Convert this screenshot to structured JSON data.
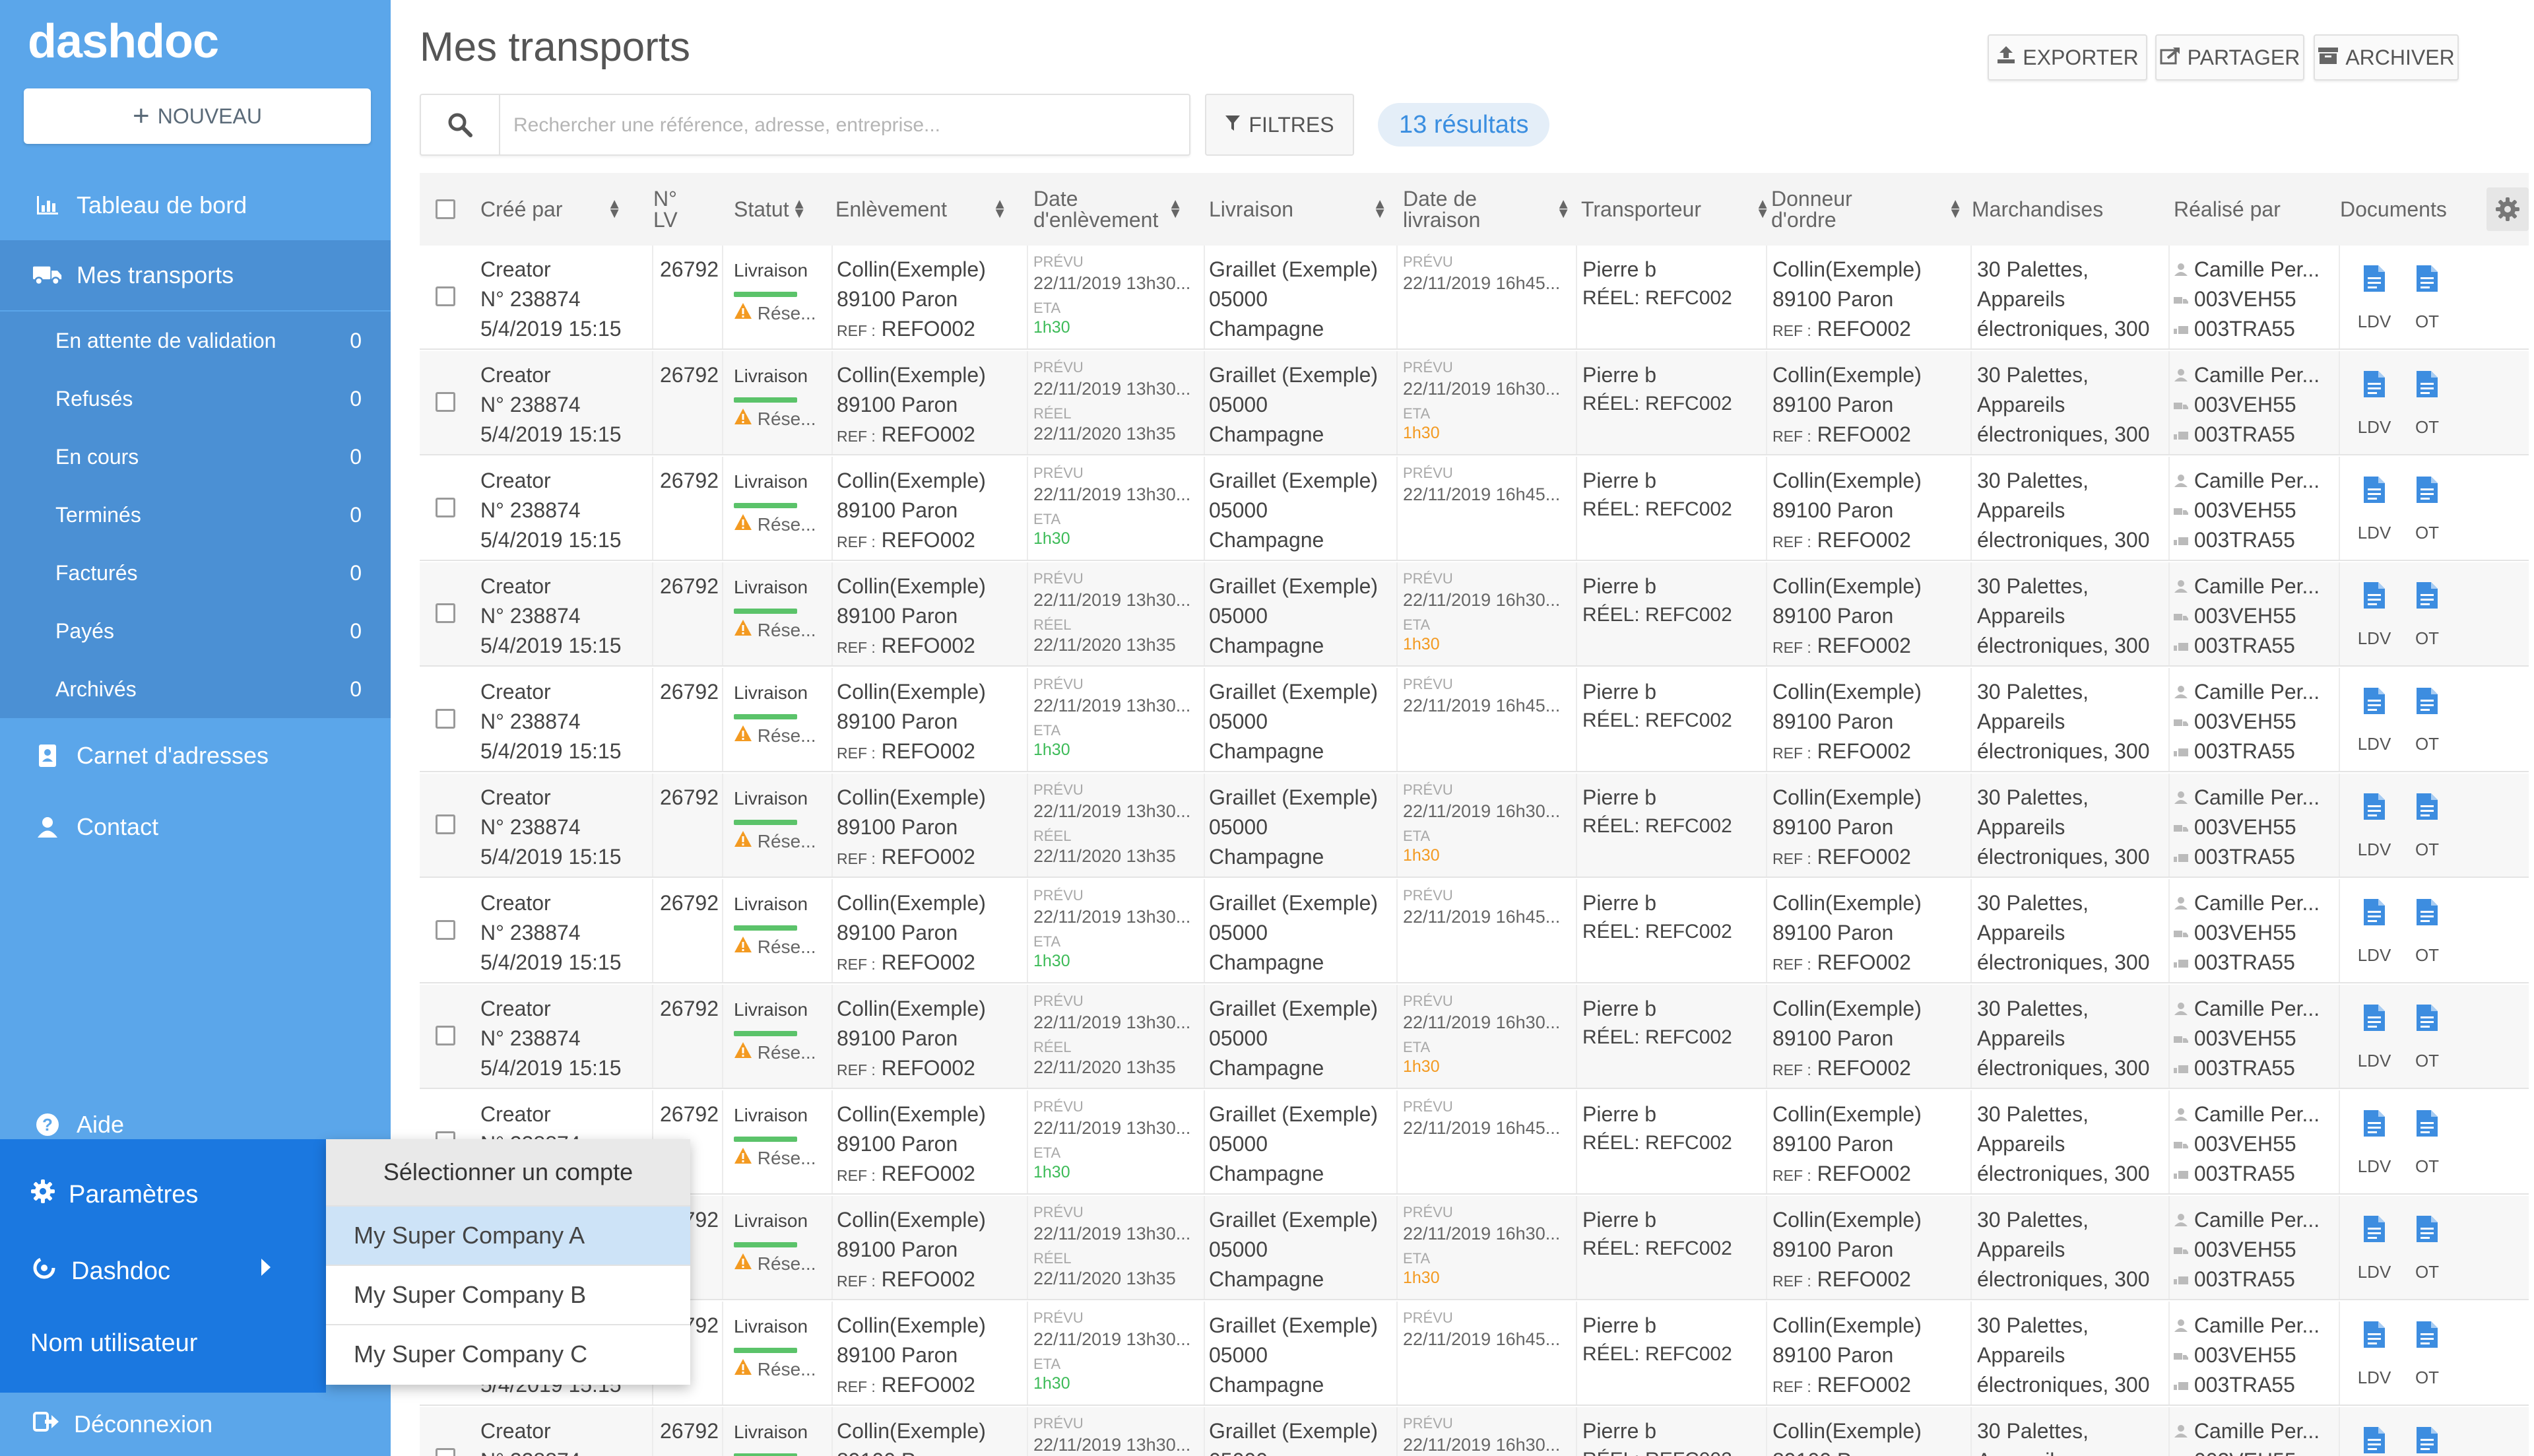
{
  "app": {
    "logo": "dashdoc"
  },
  "sidebar": {
    "new_button": "NOUVEAU",
    "nav": {
      "dashboard": "Tableau de bord",
      "transports": "Mes transports",
      "addresses": "Carnet d'adresses",
      "contact": "Contact",
      "help": "Aide"
    },
    "sub_items": [
      {
        "label": "En attente de validation",
        "count": "0"
      },
      {
        "label": "Refusés",
        "count": "0"
      },
      {
        "label": "En cours",
        "count": "0"
      },
      {
        "label": "Terminés",
        "count": "0"
      },
      {
        "label": "Facturés",
        "count": "0"
      },
      {
        "label": "Payés",
        "count": "0"
      },
      {
        "label": "Archivés",
        "count": "0"
      }
    ],
    "bottom": {
      "settings": "Paramètres",
      "company": "Dashdoc",
      "username": "Nom utilisateur",
      "logout": "Déconnexion"
    }
  },
  "account_menu": {
    "title": "Sélectionner un compte",
    "items": [
      "My Super Company A",
      "My Super Company B",
      "My Super Company C"
    ],
    "selected": "My Super Company A"
  },
  "header": {
    "title": "Mes transports",
    "actions": {
      "export": "EXPORTER",
      "share": "PARTAGER",
      "archive": "ARCHIVER"
    }
  },
  "search": {
    "placeholder": "Rechercher une référence, adresse, entreprise..."
  },
  "filters": {
    "label": "FILTRES"
  },
  "results": {
    "label": "13 résultats"
  },
  "table": {
    "columns": {
      "created_by": "Créé par",
      "lv_line1": "N°",
      "lv_line2": "LV",
      "status": "Statut",
      "pickup": "Enlèvement",
      "pickup_date_line1": "Date",
      "pickup_date_line2": "d'enlèvement",
      "delivery": "Livraison",
      "delivery_date_line1": "Date de",
      "delivery_date_line2": "livraison",
      "carrier": "Transporteur",
      "shipper_line1": "Donneur",
      "shipper_line2": "d'ordre",
      "goods": "Marchandises",
      "done_by": "Réalisé par",
      "documents": "Documents"
    },
    "row_common": {
      "creator": "Creator",
      "number": "N° 238874",
      "created_at": "5/4/2019 15:15",
      "lv": "26792",
      "status": "Livraison",
      "status_sub": "Rése...",
      "pickup_company": "Collin(Exemple)",
      "pickup_city": "89100 Paron",
      "ref_label": "REF :",
      "ref": "REFO002",
      "planned_label": "PRÉVU",
      "planned_pickup": "22/11/2019 13h30...",
      "eta_label": "ETA",
      "real_label": "RÉEL",
      "real_date": "22/11/2020 13h35",
      "eta_value": "1h30",
      "delivery_company": "Graillet (Exemple)",
      "delivery_zip": "05000",
      "delivery_city": "Champagne",
      "delivery_planned_a": "22/11/2019 16h45...",
      "delivery_planned_b": "22/11/2019 16h30...",
      "carrier_name": "Pierre b",
      "carrier_ref": "RÉEL: REFC002",
      "shipper_company": "Collin(Exemple)",
      "shipper_city": "89100 Paron",
      "goods_l1": "30 Palettes,",
      "goods_l2": "Appareils",
      "goods_l3": "électroniques, 300",
      "driver": "Camille Per...",
      "vehicle": "003VEH55",
      "trailer": "003TRA55",
      "doc_ldv": "LDV",
      "doc_ot": "OT"
    },
    "row_variants": [
      "eta",
      "real",
      "eta",
      "real",
      "eta",
      "real",
      "eta",
      "real",
      "eta",
      "real",
      "eta",
      "real"
    ]
  },
  "colors": {
    "sidebar": "#5ba6ea",
    "sidebar_active": "#4b90d4",
    "sidebar_bottom": "#1b78e0",
    "accent": "#3a8ee0",
    "status_green": "#5bc36a",
    "warning": "#f39a21"
  },
  "icons": {
    "dashboard": "chart-icon",
    "transports": "truck-icon",
    "addresses": "address-book-icon",
    "contact": "user-icon",
    "help": "question-icon",
    "settings": "gear-icon",
    "company": "dashdoc-logo-icon",
    "logout": "logout-icon",
    "search": "search-icon",
    "filter": "filter-icon",
    "export": "upload-icon",
    "share": "share-icon",
    "archive": "archive-icon",
    "document": "document-icon"
  }
}
